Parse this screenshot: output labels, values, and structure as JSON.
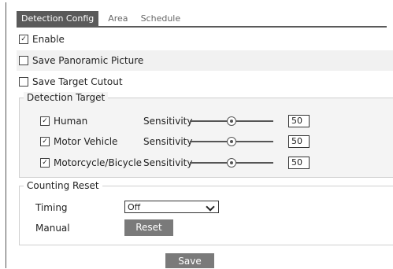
{
  "tabs": [
    "Detection Config",
    "Area",
    "Schedule"
  ],
  "enable": {
    "label": "Enable",
    "checked": true
  },
  "save_panoramic": {
    "label": "Save Panoramic Picture",
    "checked": false
  },
  "save_target": {
    "label": "Save Target Cutout",
    "checked": false
  },
  "detection_target": {
    "legend": "Detection Target",
    "sensitivity_label": "Sensitivity",
    "items": [
      {
        "label": "Human",
        "checked": true,
        "value": "50"
      },
      {
        "label": "Motor Vehicle",
        "checked": true,
        "value": "50"
      },
      {
        "label": "Motorcycle/Bicycle",
        "checked": true,
        "value": "50"
      }
    ]
  },
  "counting_reset": {
    "legend": "Counting Reset",
    "timing_label": "Timing",
    "timing_value": "Off",
    "manual_label": "Manual",
    "reset_button": "Reset"
  },
  "save_button": "Save"
}
